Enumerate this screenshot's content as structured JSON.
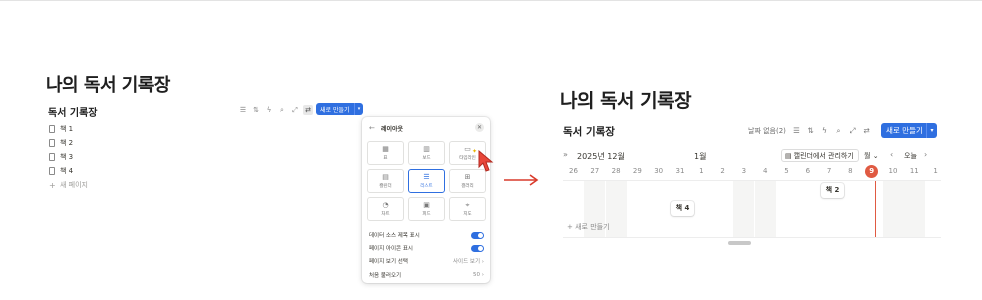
{
  "left": {
    "page_title": "나의 독서 기록장",
    "db_title": "독서 기록장",
    "toolbar_icons": [
      "filter-icon",
      "sort-icon",
      "lightning-icon",
      "search-icon",
      "expand-icon",
      "settings-sliders-icon"
    ],
    "new_button": "새로 만들기",
    "items": [
      "책 1",
      "책 2",
      "책 3",
      "책 4"
    ],
    "add_page": "새 페이지",
    "popup": {
      "back": "←",
      "title": "레이아웃",
      "close": "✕",
      "layouts": [
        {
          "label": "표",
          "icon": "table-icon"
        },
        {
          "label": "보드",
          "icon": "board-icon"
        },
        {
          "label": "타임라인",
          "icon": "timeline-icon"
        },
        {
          "label": "캘린더",
          "icon": "calendar-icon"
        },
        {
          "label": "리스트",
          "icon": "list-icon"
        },
        {
          "label": "갤러리",
          "icon": "gallery-icon"
        },
        {
          "label": "차트",
          "icon": "chart-icon"
        },
        {
          "label": "피드",
          "icon": "feed-icon"
        },
        {
          "label": "지도",
          "icon": "map-icon"
        }
      ],
      "selected_layout": "리스트",
      "options": [
        {
          "label": "데이터 소스 제목 표시",
          "type": "toggle",
          "on": true
        },
        {
          "label": "페이지 아이콘 표시",
          "type": "toggle",
          "on": true
        },
        {
          "label": "페이지 보기 선택",
          "type": "select",
          "value": "사이드 보기"
        },
        {
          "label": "처음 불러오기",
          "type": "select",
          "value": "50"
        }
      ]
    }
  },
  "right": {
    "page_title": "나의 독서 기록장",
    "db_title": "독서 기록장",
    "no_date": "날짜 없음(2)",
    "toolbar_icons": [
      "filter-icon",
      "sort-icon",
      "lightning-icon",
      "search-icon",
      "expand-icon",
      "settings-sliders-icon"
    ],
    "new_button": "새로 만들기",
    "month_label_left": "2025년 12월",
    "month_label_right": "1월",
    "manage_calendar": "캘린더에서 관리하기",
    "view_unit": "월",
    "today": "오늘",
    "days": [
      "26",
      "27",
      "28",
      "29",
      "30",
      "31",
      "1",
      "2",
      "3",
      "4",
      "5",
      "6",
      "7",
      "8",
      "9",
      "10",
      "11",
      "1"
    ],
    "today_day": "9",
    "cards": [
      {
        "title": "책 4"
      },
      {
        "title": "책 2"
      }
    ],
    "add_new": "새로 만들기"
  },
  "colors": {
    "accent": "#2f6fe0",
    "today": "#e05a42",
    "arrow": "#d93a2b"
  }
}
